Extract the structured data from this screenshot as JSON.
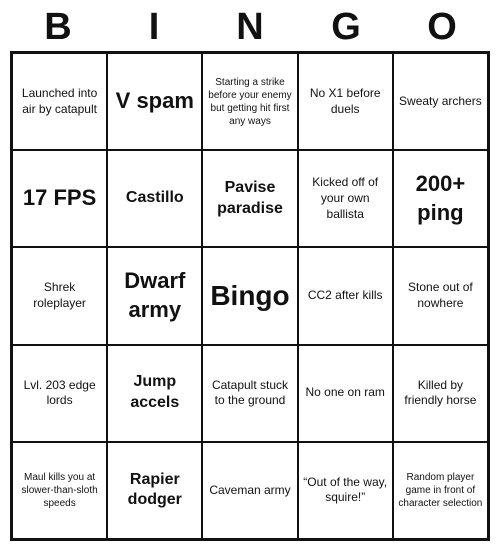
{
  "header": {
    "letters": [
      "B",
      "I",
      "N",
      "G",
      "O"
    ]
  },
  "grid": [
    [
      {
        "text": "Launched into air by catapult",
        "style": "normal"
      },
      {
        "text": "V spam",
        "style": "large"
      },
      {
        "text": "Starting a strike before your enemy but getting hit first any ways",
        "style": "small"
      },
      {
        "text": "No X1 before duels",
        "style": "normal"
      },
      {
        "text": "Sweaty archers",
        "style": "normal"
      }
    ],
    [
      {
        "text": "17 FPS",
        "style": "large"
      },
      {
        "text": "Castillo",
        "style": "medium"
      },
      {
        "text": "Pavise paradise",
        "style": "medium"
      },
      {
        "text": "Kicked off of your own ballista",
        "style": "normal"
      },
      {
        "text": "200+ ping",
        "style": "large"
      }
    ],
    [
      {
        "text": "Shrek roleplayer",
        "style": "normal"
      },
      {
        "text": "Dwarf army",
        "style": "large"
      },
      {
        "text": "Bingo",
        "style": "bingo"
      },
      {
        "text": "CC2 after kills",
        "style": "normal"
      },
      {
        "text": "Stone out of nowhere",
        "style": "normal"
      }
    ],
    [
      {
        "text": "Lvl. 203 edge lords",
        "style": "normal"
      },
      {
        "text": "Jump accels",
        "style": "medium"
      },
      {
        "text": "Catapult stuck to the ground",
        "style": "normal"
      },
      {
        "text": "No one on ram",
        "style": "normal"
      },
      {
        "text": "Killed by friendly horse",
        "style": "normal"
      }
    ],
    [
      {
        "text": "Maul kills you at slower-than-sloth speeds",
        "style": "small"
      },
      {
        "text": "Rapier dodger",
        "style": "medium"
      },
      {
        "text": "Caveman army",
        "style": "normal"
      },
      {
        "text": "“Out of the way, squire!”",
        "style": "normal"
      },
      {
        "text": "Random player game in front of character selection",
        "style": "small"
      }
    ]
  ]
}
